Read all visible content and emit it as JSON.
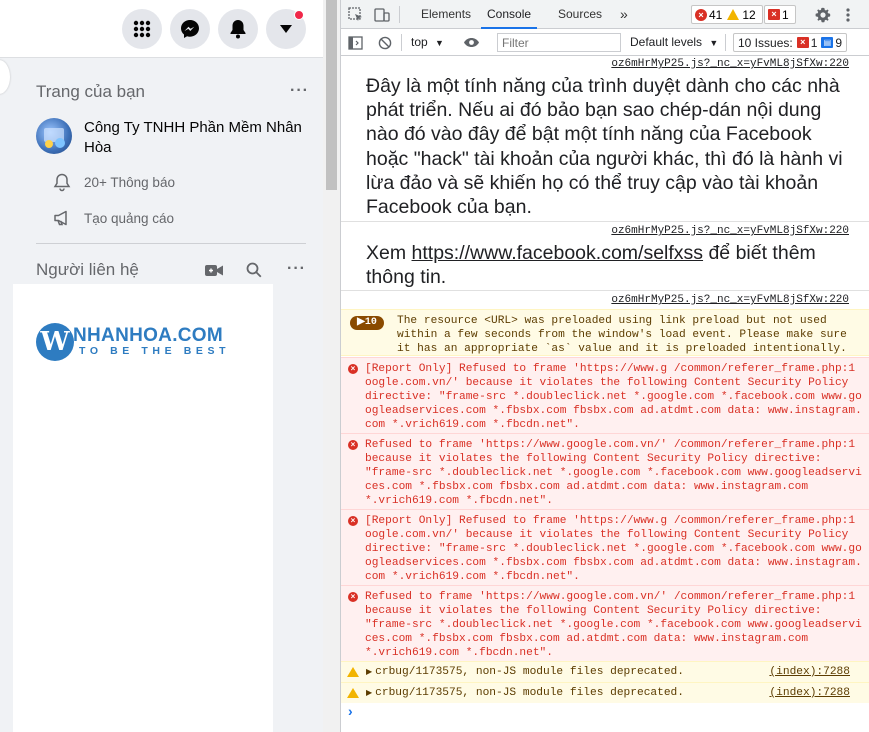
{
  "facebook": {
    "your_pages_title": "Trang của bạn",
    "page_name": "Công Ty TNHH Phần Mềm Nhân Hòa",
    "notifications": "20+ Thông báo",
    "create_ad": "Tạo quảng cáo",
    "contacts_title": "Người liên hệ",
    "more": "···",
    "ad_logo": {
      "letter": "W",
      "main": "NHANHOA.COM",
      "tagline": "TO BE THE BEST"
    },
    "accent": "#1877f2"
  },
  "devtools": {
    "tabs": [
      "Elements",
      "Console",
      "Sources",
      "»"
    ],
    "active_tab": "Console",
    "error_count": "41",
    "warning_count": "12",
    "issue_count": "1",
    "context": "top",
    "filter_placeholder": "Filter",
    "levels": "Default levels",
    "issues_label": "10 Issues:",
    "issues_err": "1",
    "issues_info": "9",
    "source_link": "oz6mHrMyP25.js?_nc_x=yFvML8jSfXw:220",
    "msg1": "Đây là một tính năng của trình duyệt dành cho các nhà phát triển. Nếu ai đó bảo bạn sao chép-dán nội dung nào đó vào đây để bật một tính năng của Facebook hoặc \"hack\" tài khoản của người khác, thì đó là hành vi lừa đảo và sẽ khiến họ có thể truy cập vào tài khoản Facebook của bạn.",
    "msg2_prefix": "Xem ",
    "msg2_link": "https://www.facebook.com/selfxss",
    "msg2_suffix": " để biết thêm thông tin.",
    "preload_count": "10",
    "preload_l1": "The resource <URL> was preloaded using link preload but not used",
    "preload_l2": "within a few seconds from the window's load event. Please make sure",
    "preload_l3": "it has an appropriate `as` value and it is preloaded intentionally.",
    "err1": [
      "[Report Only] Refused to frame 'https://www.g /common/referer_frame.php:1",
      "oogle.com.vn/' because it violates the following Content Security Policy",
      "directive: \"frame-src *.doubleclick.net *.google.com *.facebook.com www.go",
      "ogleadservices.com *.fbsbx.com fbsbx.com ad.atdmt.com data: www.instagram.",
      "com *.vrich619.com *.fbcdn.net\"."
    ],
    "err2": [
      "Refused to frame 'https://www.google.com.vn/' /common/referer_frame.php:1",
      "because it violates the following Content Security Policy directive:",
      "\"frame-src *.doubleclick.net *.google.com *.facebook.com www.googleadservi",
      "ces.com *.fbsbx.com fbsbx.com ad.atdmt.com data: www.instagram.com",
      "*.vrich619.com *.fbcdn.net\"."
    ],
    "err3": [
      "[Report Only] Refused to frame 'https://www.g /common/referer_frame.php:1",
      "oogle.com.vn/' because it violates the following Content Security Policy",
      "directive: \"frame-src *.doubleclick.net *.google.com *.facebook.com www.go",
      "ogleadservices.com *.fbsbx.com fbsbx.com ad.atdmt.com data: www.instagram.",
      "com *.vrich619.com *.fbcdn.net\"."
    ],
    "err4": [
      "Refused to frame 'https://www.google.com.vn/' /common/referer_frame.php:1",
      "because it violates the following Content Security Policy directive:",
      "\"frame-src *.doubleclick.net *.google.com *.facebook.com www.googleadservi",
      "ces.com *.fbsbx.com fbsbx.com ad.atdmt.com data: www.instagram.com",
      "*.vrich619.com *.fbcdn.net\"."
    ],
    "warn_text": "crbug/1173575, non-JS module files deprecated.",
    "warn_src": "(index):7288",
    "prompt": "›"
  }
}
